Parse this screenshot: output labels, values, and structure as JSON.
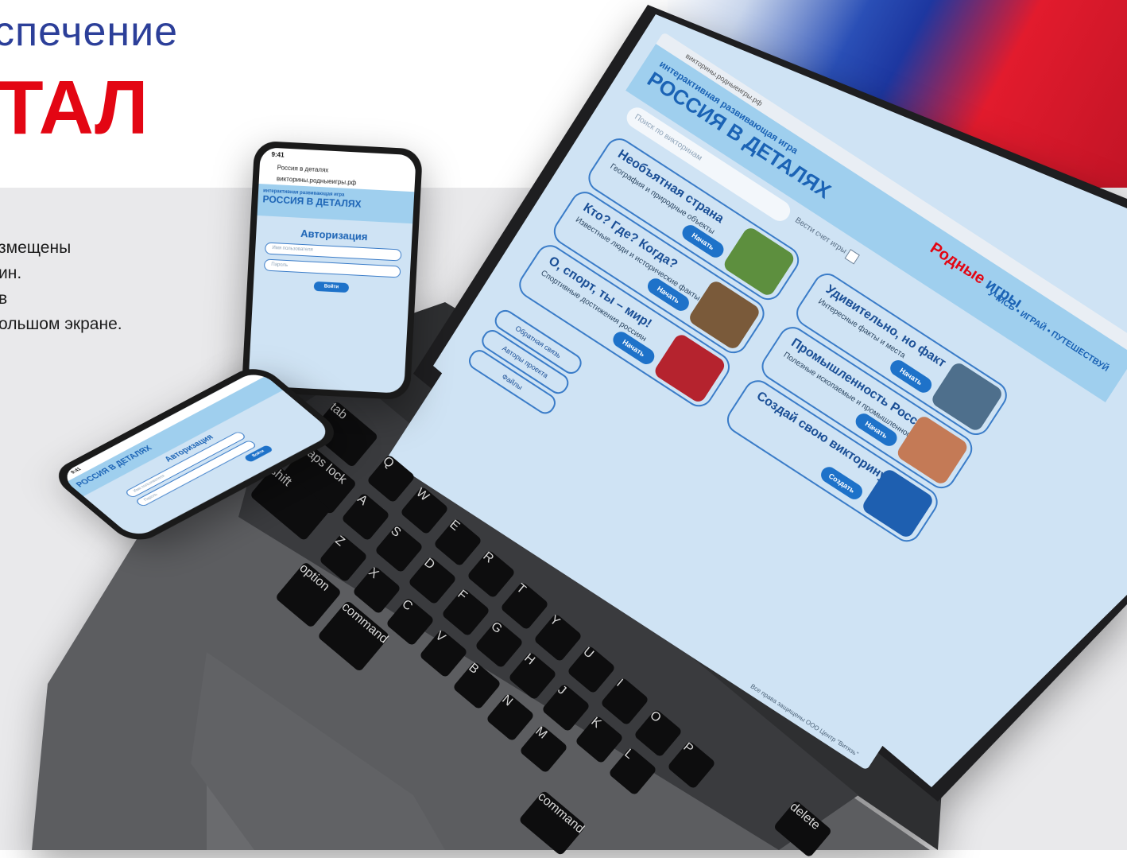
{
  "slide": {
    "title_line1": "спечение",
    "title_line2": "ТАЛ",
    "description": [
      "змещены",
      "ин.",
      "в",
      "ольшом экране."
    ]
  },
  "app": {
    "address": "викторины.родныеигры.рф",
    "kicker": "интерактивная развивающая игра",
    "brand": "РОССИЯ В ДЕТАЛЯХ",
    "logo_word1": "Родные",
    "logo_word2": "игры",
    "motto": "УЧИСЬ • ИГРАЙ • ПУТЕШЕСТВУЙ",
    "search_placeholder": "Поиск по викторинам",
    "score_label": "Вести счет игры",
    "quizzes": [
      {
        "title": "Необъятная страна",
        "subtitle": "География и природные объекты",
        "button": "Начать",
        "color": "#5d8f3e"
      },
      {
        "title": "Кто? Где? Когда?",
        "subtitle": "Известные люди и исторические факты",
        "button": "Начать",
        "color": "#7a5a3a"
      },
      {
        "title": "О, спорт, ты – мир!",
        "subtitle": "Спортивные достижения россиян",
        "button": "Начать",
        "color": "#b5232e"
      },
      {
        "title": "Удивительно, но факт",
        "subtitle": "Интересные факты и места",
        "button": "Начать",
        "color": "#4e6f8c"
      },
      {
        "title": "Промышленность России",
        "subtitle": "Полезные ископаемые и промышленность",
        "button": "Начать",
        "color": "#c47a56"
      },
      {
        "title": "Создай свою викторину",
        "subtitle": "",
        "button": "Создать",
        "color": "#1e5fb0"
      }
    ],
    "side_tabs": [
      "Обратная связь",
      "Авторы проекта",
      "Файлы"
    ],
    "footer": "Все права защищены ООО Центр \"Витязь\""
  },
  "phone": {
    "time": "9:41",
    "tab_title": "Россия в деталях",
    "address": "викторины.родныеигры.рф",
    "kicker": "интерактивная развивающая игра",
    "brand": "РОССИЯ В ДЕТАЛЯХ",
    "auth_title": "Авторизация",
    "username_placeholder": "Имя пользователя",
    "password_placeholder": "Пароль",
    "login_button": "Войти"
  },
  "keyboard": {
    "keys": [
      "tab",
      "caps lock",
      "shift",
      "option",
      "command",
      "command",
      "delete",
      "Q",
      "W",
      "E",
      "R",
      "T",
      "Y",
      "U",
      "I",
      "O",
      "P",
      "A",
      "S",
      "D",
      "F",
      "G",
      "H",
      "J",
      "K",
      "L",
      "Z",
      "X",
      "C",
      "V",
      "B",
      "N",
      "M"
    ]
  }
}
